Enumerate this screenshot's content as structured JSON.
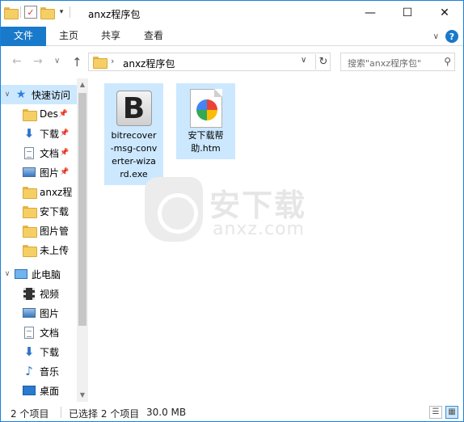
{
  "window": {
    "title": "anxz程序包",
    "minimize": "—",
    "maximize": "☐",
    "close": "✕"
  },
  "ribbon": {
    "tabs": [
      "文件",
      "主页",
      "共享",
      "查看"
    ],
    "expand_icon": "chevron-down-icon",
    "help_label": "?"
  },
  "address": {
    "path_separator": "›",
    "path": "anxz程序包",
    "back": "←",
    "forward": "→",
    "history": "∨",
    "up": "↑",
    "dropdown": "∨",
    "refresh": "↻"
  },
  "search": {
    "placeholder": "搜索\"anxz程序包\"",
    "icon": "⚲"
  },
  "sidebar": {
    "quick_access": "快速访问",
    "quick_items": [
      {
        "label": "Des",
        "icon": "folder-icon",
        "pinned": true
      },
      {
        "label": "下载",
        "icon": "download-icon",
        "pinned": true
      },
      {
        "label": "文档",
        "icon": "document-icon",
        "pinned": true
      },
      {
        "label": "图片",
        "icon": "picture-icon",
        "pinned": true
      },
      {
        "label": "anxz程",
        "icon": "folder-icon",
        "pinned": false
      },
      {
        "label": "安下载",
        "icon": "folder-icon",
        "pinned": false
      },
      {
        "label": "图片管",
        "icon": "folder-icon",
        "pinned": false
      },
      {
        "label": "未上传",
        "icon": "folder-icon",
        "pinned": false
      }
    ],
    "this_pc": "此电脑",
    "pc_items": [
      {
        "label": "视频",
        "icon": "video-icon"
      },
      {
        "label": "图片",
        "icon": "picture-icon"
      },
      {
        "label": "文档",
        "icon": "document-icon"
      },
      {
        "label": "下载",
        "icon": "download-icon"
      },
      {
        "label": "音乐",
        "icon": "music-icon"
      },
      {
        "label": "桌面",
        "icon": "desktop-icon"
      }
    ]
  },
  "files": [
    {
      "name": "bitrecover-msg-converter-wizard.exe",
      "display": "bitrecover\n-msg-conv\nerter-wiza\nrd.exe",
      "icon": "exe-app-icon",
      "selected": true
    },
    {
      "name": "安下载帮助.htm",
      "display": "安下载帮\n助.htm",
      "icon": "htm-file-icon",
      "selected": true
    }
  ],
  "watermark": {
    "text": "安下载",
    "sub": "anxz.com"
  },
  "status": {
    "item_count": "2 个项目",
    "selected": "已选择 2 个项目",
    "size": "30.0 MB"
  },
  "colors": {
    "accent": "#1979ca",
    "selection": "#cce8ff"
  }
}
